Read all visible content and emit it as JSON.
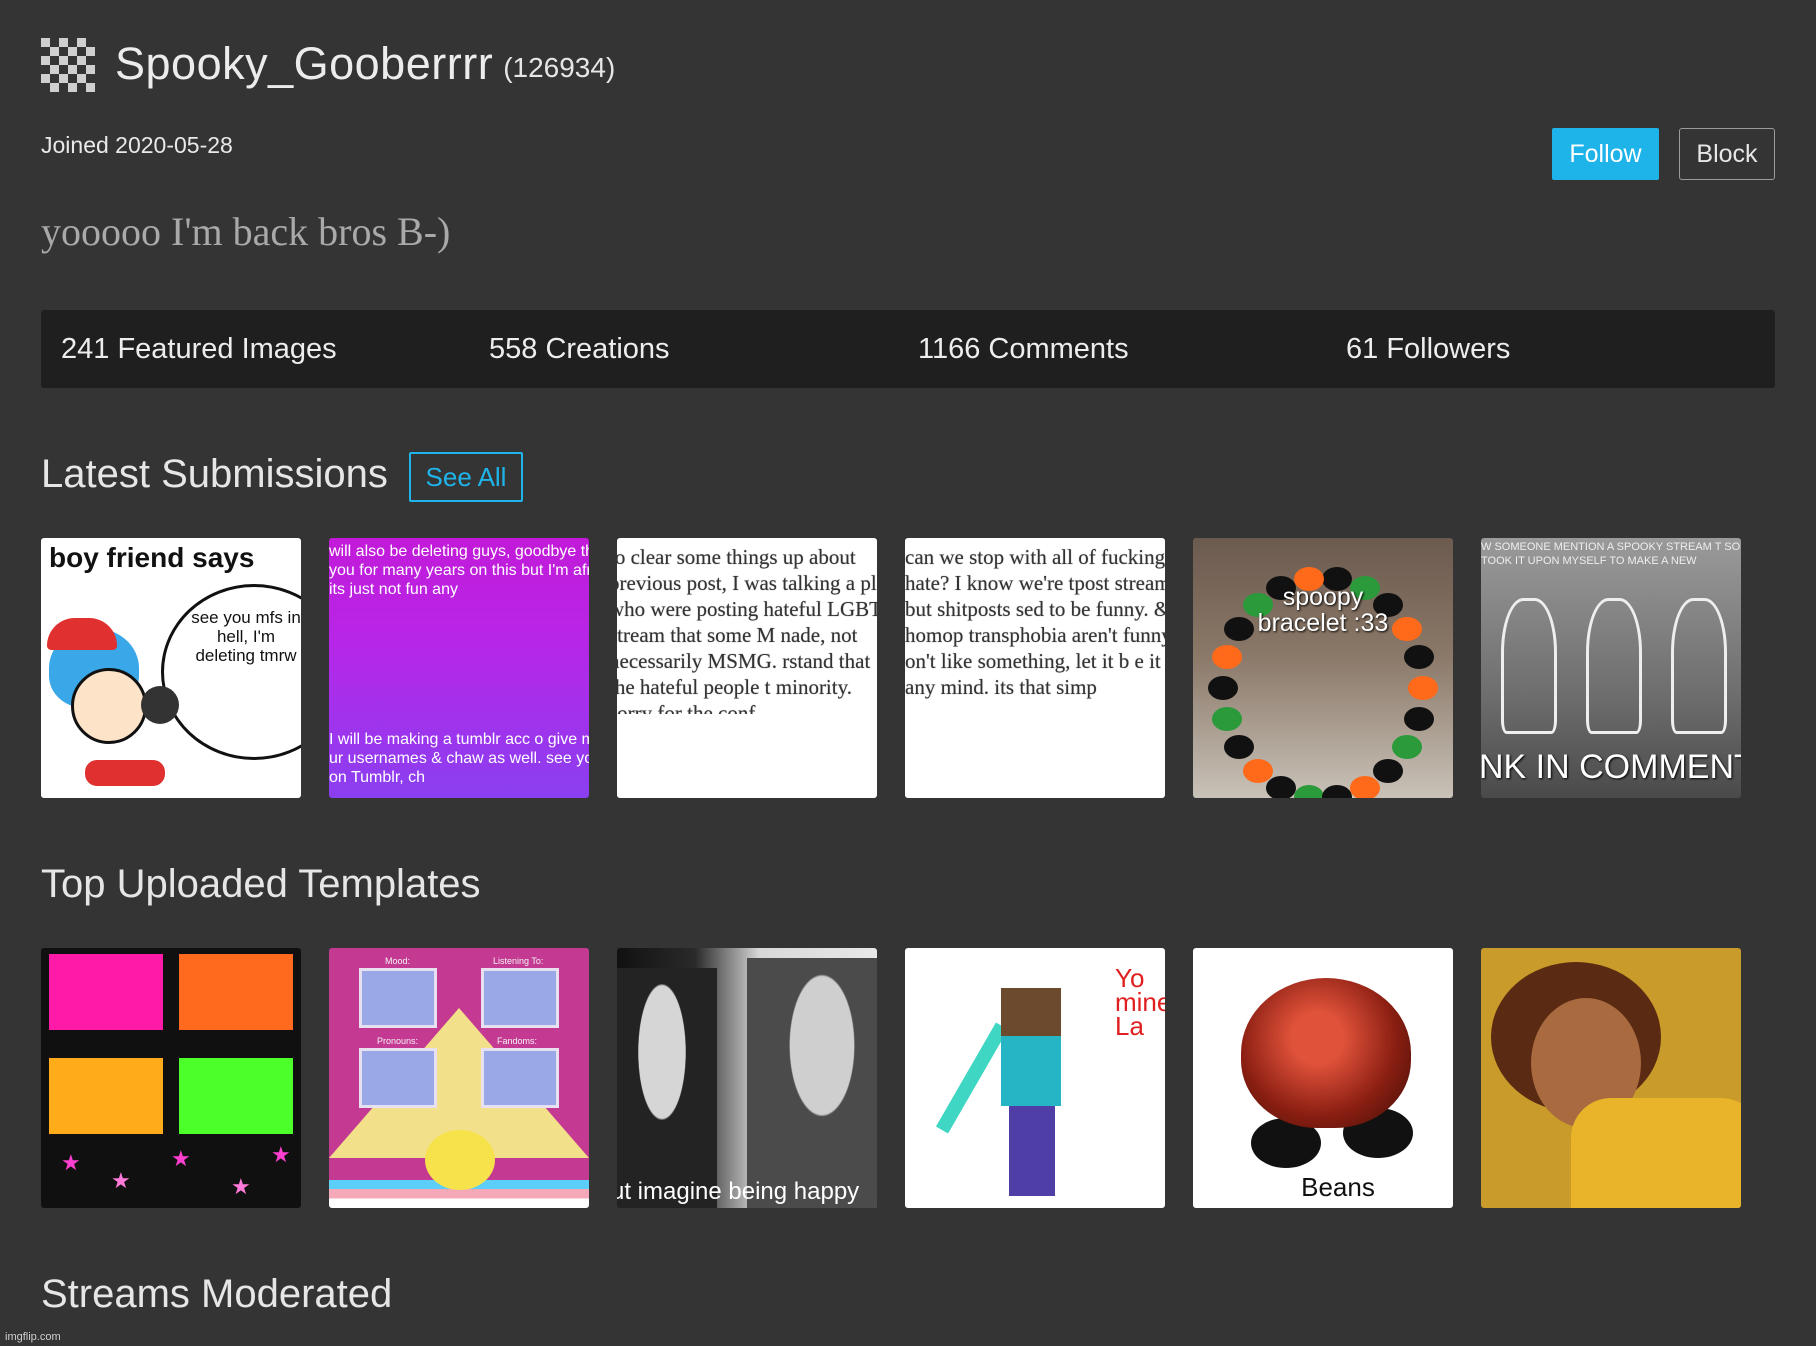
{
  "user": {
    "name": "Spooky_Gooberrrr",
    "id_text": "(126934)",
    "joined": "Joined 2020-05-28",
    "bio": "yooooo I'm back bros B-)"
  },
  "actions": {
    "follow": "Follow",
    "block": "Block"
  },
  "stats": [
    "241 Featured Images",
    "558 Creations",
    "1166 Comments",
    "61 Followers"
  ],
  "sections": {
    "latest": "Latest Submissions",
    "see_all": "See All",
    "templates": "Top Uploaded Templates",
    "streams": "Streams Moderated"
  },
  "submissions": {
    "s1": {
      "caption": "boy friend says",
      "bubble": "see you mfs in hell, I'm deleting tmrw"
    },
    "s2": {
      "top": "will also be deleting guys, goodbye thank you for many years on this but I'm afraid its just not fun any",
      "bottom": "I will be making a tumblr acc o give me ur usernames & chaw as well. see you on Tumblr, ch"
    },
    "s3": {
      "text": "to clear some things up about previous post, I was talking a ple who were posting hateful LGBTQ stream that some M nade, not necessarily MSMG. rstand that the hateful people t minority. sorry for the conf"
    },
    "s4": {
      "text": "can we stop with all of fucking hate? I know we're tpost stream, but shitposts sed to be funny. & homop transphobia aren't funny. if on't like something, let it b e it any mind. its that simp"
    },
    "s5": {
      "text": "spoopy bracelet :33"
    },
    "s6": {
      "header": "W SOMEONE MENTION A SPOOKY STREAM T SO I TOOK IT UPON MYSELF TO MAKE A NEW",
      "bottom": "NK IN COMMENT"
    }
  },
  "templates": {
    "t2_labels": [
      "Mood:",
      "Listening To:",
      "Pronouns:",
      "Fandoms:"
    ],
    "t3_caption": "ut imagine being happy",
    "t4_text": "Yo mine La",
    "t5_caption": "Beans"
  },
  "colors": {
    "accent": "#1fb4e9",
    "background": "#343434",
    "stats_bar": "#1f1f1f"
  },
  "footer": {
    "credit": "imgflip.com"
  }
}
